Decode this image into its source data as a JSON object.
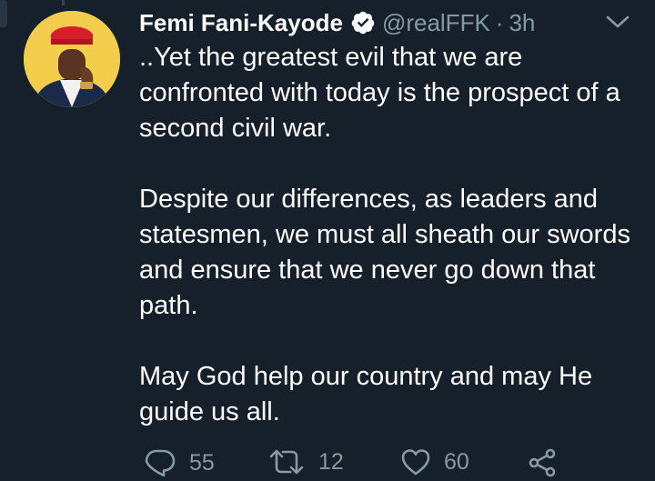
{
  "tweet": {
    "author_name": "Femi Fani-Kayode",
    "handle": "@realFFK",
    "separator": "·",
    "time": "3h",
    "paragraphs": [
      "..Yet the greatest evil that we are confronted with today is the prospect of a second civil war.",
      "Despite our differences, as leaders and statesmen, we must all sheath our swords and ensure that we never go down that path.",
      "May God help our country and may He guide us all."
    ]
  },
  "actions": {
    "reply_count": "55",
    "retweet_count": "12",
    "like_count": "60"
  },
  "icons": {
    "verified": "verified-badge-icon",
    "caret": "chevron-down-icon",
    "reply": "reply-icon",
    "retweet": "retweet-icon",
    "like": "heart-icon",
    "share": "share-icon"
  },
  "colors": {
    "background": "#15202b",
    "text": "#ffffff",
    "secondary_text": "#8899a6",
    "avatar_background": "#f4cd4d"
  }
}
